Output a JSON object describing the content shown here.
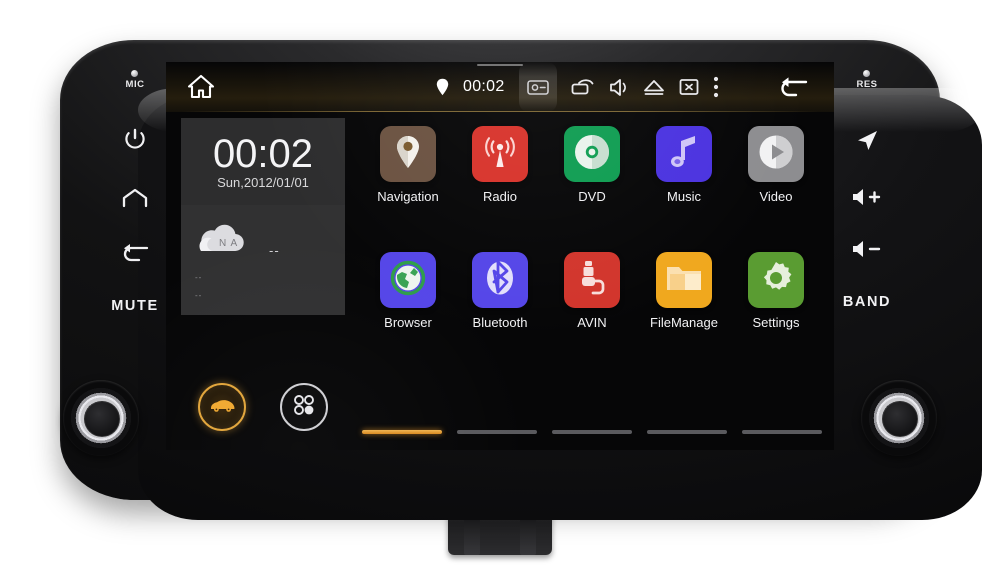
{
  "device": {
    "mic_label": "MIC",
    "res_label": "RES",
    "mute_label": "MUTE",
    "band_label": "BAND"
  },
  "statusbar": {
    "clock": "00:02",
    "icons": [
      {
        "name": "location-pin-icon"
      },
      {
        "name": "screenshot-icon"
      },
      {
        "name": "screen-rotate-icon"
      },
      {
        "name": "volume-icon"
      },
      {
        "name": "eject-icon"
      },
      {
        "name": "screen-off-icon"
      },
      {
        "name": "overflow-menu-icon"
      }
    ]
  },
  "widgets": {
    "clock": {
      "time": "00:02",
      "date": "Sun,2012/01/01"
    },
    "weather": {
      "condition": "N A",
      "temperature": "--",
      "low": "--",
      "low2": "--"
    }
  },
  "dock": {
    "car_label": "car-mode",
    "apps_label": "all-apps"
  },
  "apps": [
    {
      "label": "Navigation",
      "color": "#6b5241",
      "icon": "map-pin-icon"
    },
    {
      "label": "Radio",
      "color": "#d8332b",
      "icon": "radio-waves-icon"
    },
    {
      "label": "DVD",
      "color": "#0f9d52",
      "icon": "disc-icon"
    },
    {
      "label": "Music",
      "color": "#4b33e0",
      "icon": "music-note-icon"
    },
    {
      "label": "Video",
      "color": "#8d8d90",
      "icon": "play-circle-icon"
    },
    {
      "label": "Browser",
      "color": "#5546e8",
      "icon": "globe-icon"
    },
    {
      "label": "Bluetooth",
      "color": "#5546e8",
      "icon": "bluetooth-icon"
    },
    {
      "label": "AVIN",
      "color": "#d2352c",
      "icon": "av-plug-icon"
    },
    {
      "label": "FileManage",
      "color": "#f0a81e",
      "icon": "folder-icon"
    },
    {
      "label": "Settings",
      "color": "#5a9c32",
      "icon": "gear-icon"
    }
  ],
  "pager": {
    "pages": 5,
    "active_index": 0,
    "accent": "#e2961f"
  },
  "side_buttons": {
    "left": [
      {
        "name": "power-button",
        "label": ""
      },
      {
        "name": "home-button",
        "label": ""
      },
      {
        "name": "back-button",
        "label": ""
      },
      {
        "name": "mute-button",
        "label": "MUTE"
      }
    ],
    "right": [
      {
        "name": "navigation-button",
        "label": ""
      },
      {
        "name": "volume-up-button",
        "label": ""
      },
      {
        "name": "volume-down-button",
        "label": ""
      },
      {
        "name": "band-button",
        "label": "BAND"
      }
    ]
  }
}
